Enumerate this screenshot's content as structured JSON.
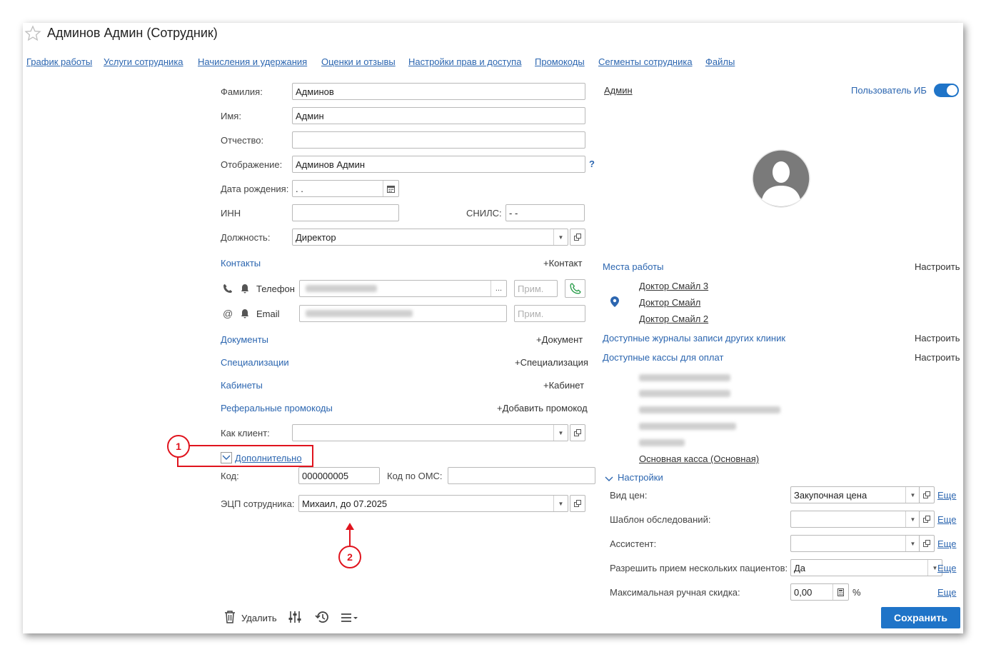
{
  "window": {
    "title": "Админов Админ (Сотрудник)"
  },
  "tabs": [
    "График работы",
    "Услуги сотрудника",
    "Начисления и удержания",
    "Оценки и отзывы",
    "Настройки прав и доступа",
    "Промокоды",
    "Сегменты сотрудника",
    "Файлы"
  ],
  "form": {
    "surname_label": "Фамилия:",
    "surname_value": "Админов",
    "name_label": "Имя:",
    "name_value": "Админ",
    "patronymic_label": "Отчество:",
    "patronymic_value": "",
    "display_label": "Отображение:",
    "display_value": "Админов Админ",
    "display_help": "?",
    "birth_label": "Дата рождения:",
    "birth_value": " .  .",
    "inn_label": "ИНН",
    "inn_value": "",
    "snils_label": "СНИЛС:",
    "snils_value": "   -   -",
    "position_label": "Должность:",
    "position_value": "Директор"
  },
  "contacts": {
    "title": "Контакты",
    "add": "+Контакт",
    "phone_label": "Телефон",
    "email_label": "Email",
    "note_placeholder": "Прим.",
    "more_btn": "..."
  },
  "sections": {
    "documents": "Документы",
    "documents_add": "+Документ",
    "specializations": "Специализации",
    "specializations_add": "+Специализация",
    "cabinets": "Кабинеты",
    "cabinets_add": "+Кабинет",
    "promocodes": "Реферальные промокоды",
    "promocodes_add": "+Добавить промокод"
  },
  "client": {
    "label": "Как клиент:",
    "value": ""
  },
  "additional": {
    "toggle": "Дополнительно",
    "code_label": "Код:",
    "code_value": "000000005",
    "oms_label": "Код по ОМС:",
    "oms_value": "",
    "signature_label": "ЭЦП сотрудника:",
    "signature_value": "Михаил, до 07.2025"
  },
  "annotations": {
    "callout1": "1",
    "callout2": "2"
  },
  "toolbar": {
    "delete": "Удалить"
  },
  "right": {
    "user_link": "Админ",
    "ib_user_label": "Пользователь ИБ",
    "workplaces_title": "Места работы",
    "configure": "Настроить",
    "workplaces": [
      "Доктор Смайл 3",
      "Доктор Смайл",
      "Доктор Смайл 2"
    ],
    "journals_title": "Доступные журналы записи других клиник",
    "cash_title": "Доступные кассы для оплат",
    "main_cash": "Основная касса (Основная)",
    "settings_title": "Настройки",
    "price_label": "Вид цен:",
    "price_value": "Закупочная цена",
    "template_label": "Шаблон обследований:",
    "template_value": "",
    "assistant_label": "Ассистент:",
    "assistant_value": "",
    "multi_label": "Разрешить прием нескольких пациентов:",
    "multi_value": "Да",
    "discount_label": "Максимальная ручная скидка:",
    "discount_value": "0,00",
    "percent": "%",
    "more": "Еще",
    "save": "Сохранить"
  },
  "colors": {
    "accent": "#2c66b0",
    "save_button": "#1f74c8",
    "callout": "#e0141e"
  }
}
